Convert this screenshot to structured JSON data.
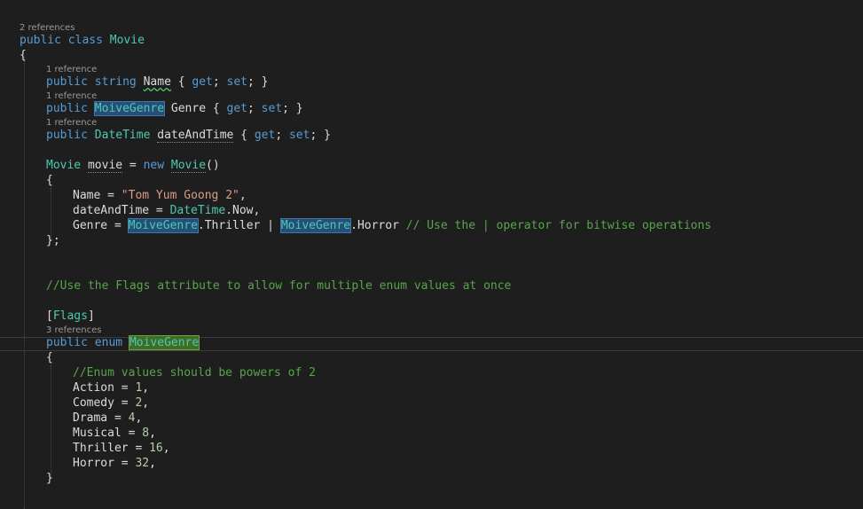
{
  "editor": {
    "code_lens": {
      "movie_class": "2 references",
      "name_prop": "1 reference",
      "genre_prop": "1 reference",
      "datetime_prop": "1 reference",
      "enum": "3 references"
    },
    "tokens": {
      "kw_public": "public",
      "kw_class": "class",
      "kw_string": "string",
      "kw_get": "get",
      "kw_set": "set",
      "kw_new": "new",
      "kw_enum": "enum",
      "type_movie": "Movie",
      "type_moivegenre": "MoiveGenre",
      "type_datetime": "DateTime",
      "type_flags": "Flags",
      "id_name": "Name",
      "id_genre": "Genre",
      "id_dateandtime": "dateAndTime",
      "id_movie_var": "movie",
      "id_now": "Now",
      "id_thriller": "Thriller",
      "id_horror": "Horror",
      "id_action": "Action",
      "id_comedy": "Comedy",
      "id_drama": "Drama",
      "id_musical": "Musical",
      "str_title": "\"Tom Yum Goong 2\"",
      "comment_bitwise": "// Use the | operator for bitwise operations",
      "comment_flags": "//Use the Flags attribute to allow for multiple enum values at once",
      "comment_powers": "//Enum values should be powers of 2",
      "num_1": "1",
      "num_2": "2",
      "num_4": "4",
      "num_8": "8",
      "num_16": "16",
      "num_32": "32"
    }
  }
}
